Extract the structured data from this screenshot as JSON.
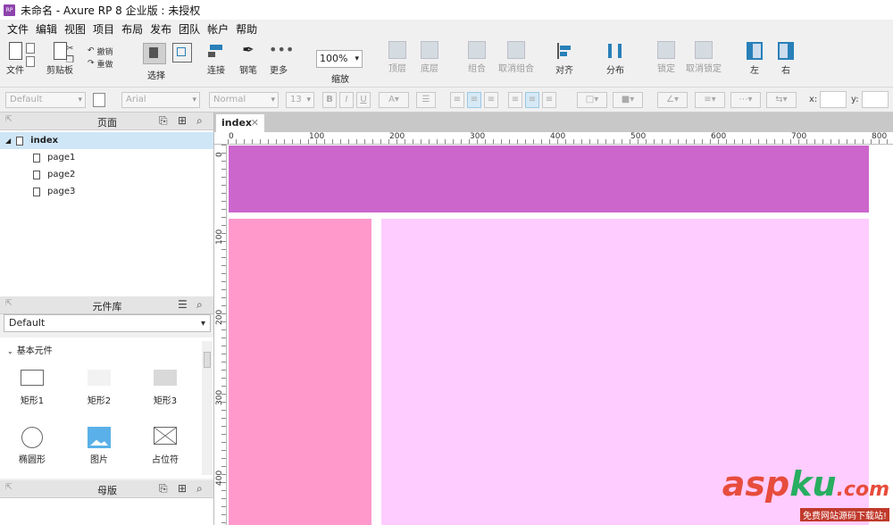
{
  "window": {
    "title": "未命名 - Axure RP 8 企业版 : 未授权",
    "logo_text": "RP"
  },
  "menu": [
    "文件",
    "编辑",
    "视图",
    "项目",
    "布局",
    "发布",
    "团队",
    "帐户",
    "帮助"
  ],
  "toolbar": {
    "file": "文件",
    "clipboard": "剪贴板",
    "undo": "撤销",
    "redo": "重做",
    "select": "选择",
    "connect": "连接",
    "pen": "钢笔",
    "more": "更多",
    "zoom_value": "100%",
    "zoom": "缩放",
    "top": "顶层",
    "bottom": "底层",
    "group": "组合",
    "ungroup": "取消组合",
    "align": "对齐",
    "distribute": "分布",
    "lock": "锁定",
    "unlock": "取消锁定",
    "left": "左",
    "right": "右"
  },
  "format": {
    "style": "Default",
    "font": "Arial",
    "weight": "Normal",
    "size": "13",
    "bold": "B",
    "italic": "I",
    "underline": "U",
    "x_label": "x:",
    "y_label": "y:"
  },
  "pages_panel": {
    "title": "页面",
    "items": [
      {
        "label": "index",
        "selected": true
      },
      {
        "label": "page1"
      },
      {
        "label": "page2"
      },
      {
        "label": "page3"
      }
    ]
  },
  "library_panel": {
    "title": "元件库",
    "selected": "Default",
    "category": "基本元件",
    "widgets": [
      "矩形1",
      "矩形2",
      "矩形3",
      "椭圆形",
      "图片",
      "占位符"
    ]
  },
  "masters_panel": {
    "title": "母版"
  },
  "canvas": {
    "tab": "index",
    "ruler_h": [
      "0",
      "100",
      "200",
      "300",
      "400",
      "500",
      "600",
      "700",
      "800"
    ],
    "ruler_v": [
      "0",
      "100",
      "200",
      "300",
      "400"
    ],
    "colors": {
      "header": "#cc66cc",
      "sidebar": "#ff99cc",
      "content": "#ffccff"
    }
  },
  "watermark": {
    "brand_a": "asp",
    "brand_b": "ku",
    "brand_c": ".com",
    "subtitle": "免费网站源码下载站!"
  }
}
